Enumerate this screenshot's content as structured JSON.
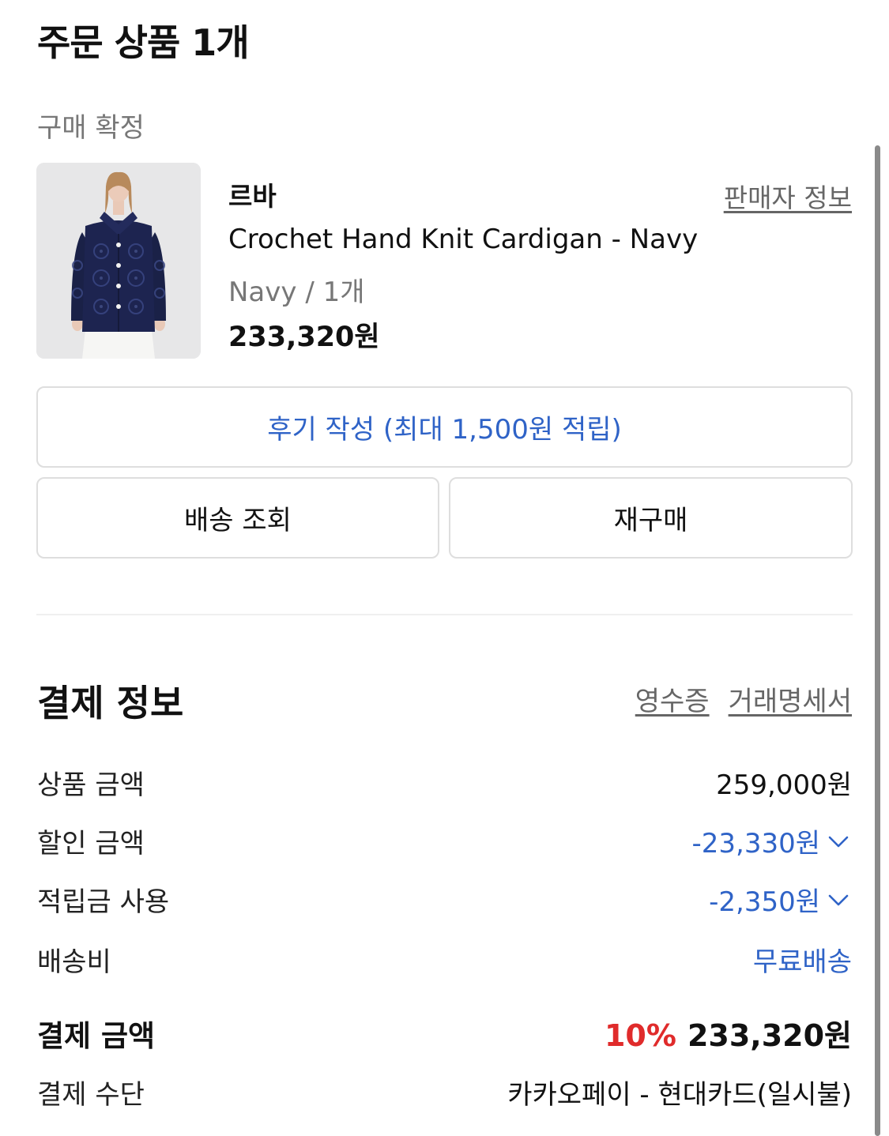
{
  "order": {
    "section_title": "주문 상품 1개",
    "status": "구매 확정",
    "brand": "르바",
    "seller_info_label": "판매자 정보",
    "product_name": "Crochet Hand Knit Cardigan - Navy",
    "option": "Navy / 1개",
    "price": "233,320원",
    "review_button_label": "후기 작성 (최대 1,500원 적립)",
    "tracking_button_label": "배송 조회",
    "reorder_button_label": "재구매"
  },
  "payment": {
    "title": "결제 정보",
    "receipt_label": "영수증",
    "statement_label": "거래명세서",
    "rows": [
      {
        "label": "상품 금액",
        "value": "259,000원"
      },
      {
        "label": "할인 금액",
        "value": "-23,330원"
      },
      {
        "label": "적립금 사용",
        "value": "-2,350원"
      },
      {
        "label": "배송비",
        "value": "무료배송"
      }
    ],
    "total_label": "결제 금액",
    "total_rate": "10%",
    "total_value": "233,320원",
    "method_label": "결제 수단",
    "method_value": "카카오페이 - 현대카드(일시불)"
  },
  "icons": {
    "discount_toggle": "chevron-down-icon",
    "points_toggle": "chevron-down-icon"
  },
  "colors": {
    "accent_blue": "#2f63c7",
    "discount_red": "#e02b2b",
    "muted_text": "#777777",
    "border": "#dedede"
  }
}
